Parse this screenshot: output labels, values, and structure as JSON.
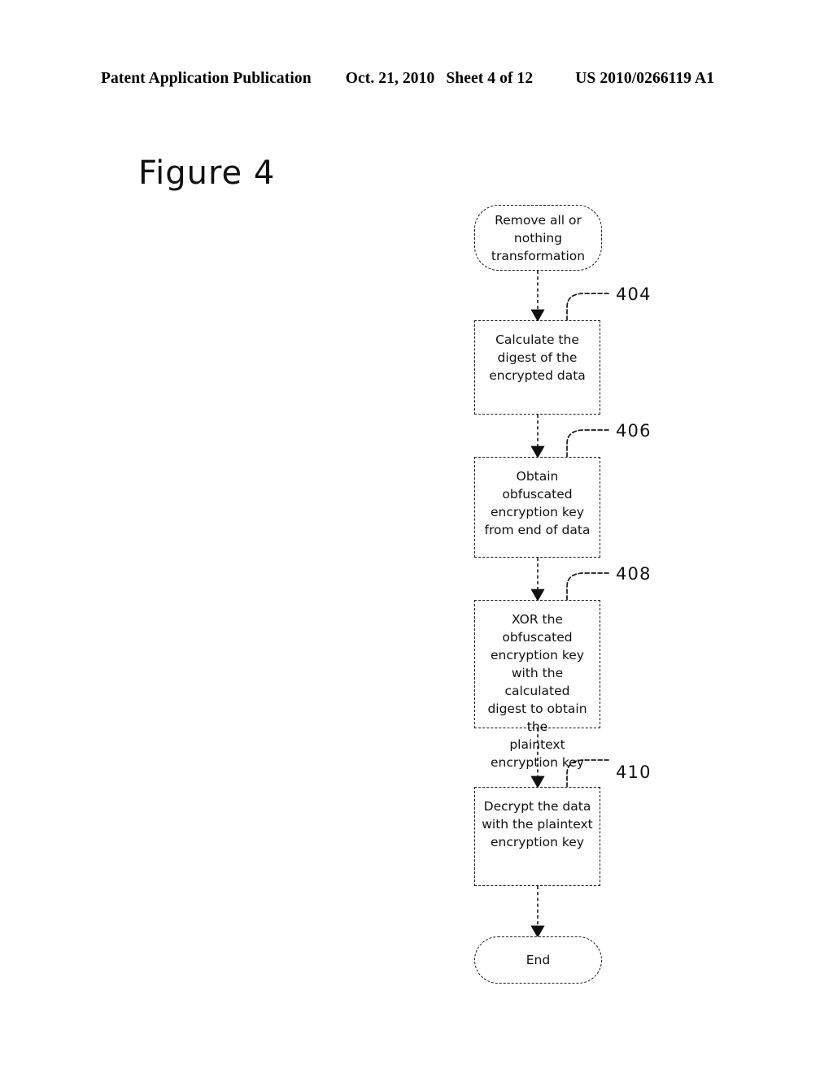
{
  "header": {
    "publication": "Patent Application Publication",
    "date": "Oct. 21, 2010",
    "sheet": "Sheet 4 of 12",
    "number": "US 2010/0266119 A1"
  },
  "figure": {
    "title": "Figure 4"
  },
  "diagram": {
    "type": "flowchart",
    "orientation": "vertical",
    "nodes": [
      {
        "id": "start",
        "shape": "terminator",
        "text": "Remove all or\nnothing\ntransformation",
        "ref": ""
      },
      {
        "id": "step-404",
        "shape": "process",
        "text": "Calculate the\ndigest of the\nencrypted data",
        "ref": "404"
      },
      {
        "id": "step-406",
        "shape": "process",
        "text": "Obtain obfuscated\nencryption key\nfrom end of data",
        "ref": "406"
      },
      {
        "id": "step-408",
        "shape": "process",
        "text": "XOR the\nobfuscated\nencryption key\nwith the calculated\ndigest to obtain the\nplaintext\nencryption key",
        "ref": "408"
      },
      {
        "id": "step-410",
        "shape": "process",
        "text": "Decrypt the data\nwith the plaintext\nencryption key",
        "ref": "410"
      },
      {
        "id": "end",
        "shape": "terminator",
        "text": "End",
        "ref": ""
      }
    ],
    "edges": [
      {
        "from": "start",
        "to": "step-404"
      },
      {
        "from": "step-404",
        "to": "step-406"
      },
      {
        "from": "step-406",
        "to": "step-408"
      },
      {
        "from": "step-408",
        "to": "step-410"
      },
      {
        "from": "step-410",
        "to": "end"
      }
    ]
  },
  "colors": {
    "ink": "#111111",
    "paper": "#ffffff"
  }
}
